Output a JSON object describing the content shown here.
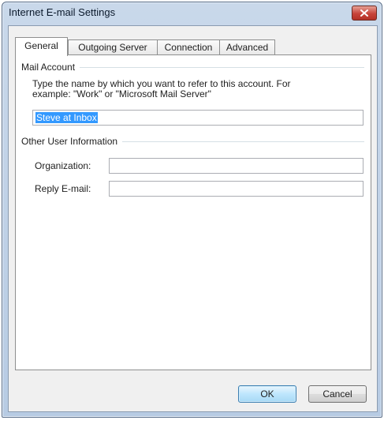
{
  "window": {
    "title": "Internet E-mail Settings"
  },
  "tabs": [
    {
      "label": "General",
      "active": true
    },
    {
      "label": "Outgoing Server",
      "active": false
    },
    {
      "label": "Connection",
      "active": false
    },
    {
      "label": "Advanced",
      "active": false
    }
  ],
  "mail_account": {
    "heading": "Mail Account",
    "instruction_line1": "Type the name by which you want to refer to this account. For",
    "instruction_line2": "example: \"Work\" or \"Microsoft Mail Server\"",
    "account_name_value": "Steve at Inbox"
  },
  "other_user_info": {
    "heading": "Other User Information",
    "organization_label": "Organization:",
    "organization_value": "",
    "reply_email_label": "Reply E-mail:",
    "reply_email_value": ""
  },
  "buttons": {
    "ok_label": "OK",
    "cancel_label": "Cancel"
  },
  "colors": {
    "selection": "#3399ff",
    "close_button": "#c7443a",
    "title_bar": "#c9d8ea"
  }
}
